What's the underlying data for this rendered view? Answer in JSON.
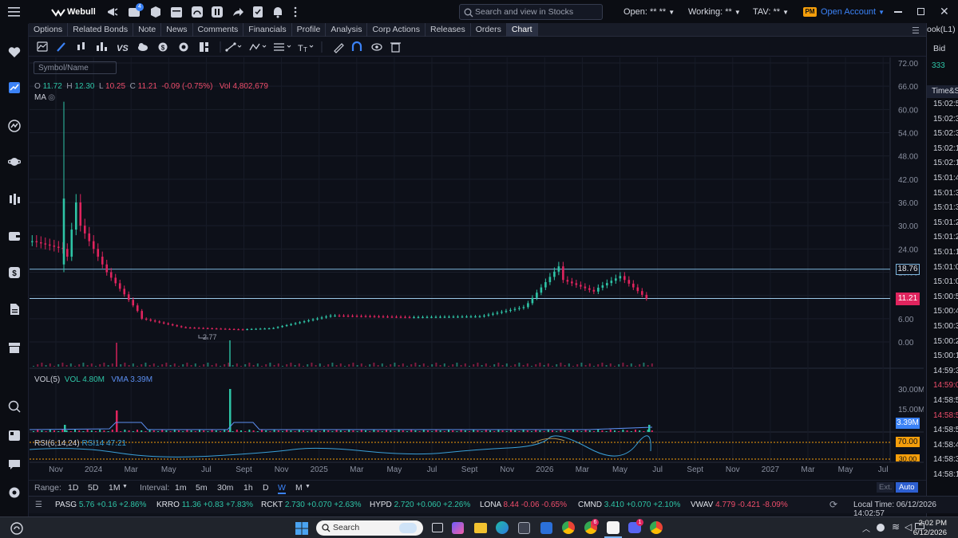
{
  "app": {
    "name": "Webull",
    "notification_badge": "4",
    "search_placeholder": "Search and view in Stocks",
    "open_label": "Open:",
    "open_value": "** **",
    "working_label": "Working:",
    "working_value": "**",
    "tav_label": "TAV:",
    "tav_value": "**",
    "pm_badge": "PM",
    "open_account": "Open Account"
  },
  "tabs": [
    "Options",
    "Related Bonds",
    "Note",
    "News",
    "Comments",
    "Financials",
    "Profile",
    "Analysis",
    "Corp Actions",
    "Releases",
    "Orders",
    "Chart"
  ],
  "active_tab": "Chart",
  "side_panel": {
    "title": "ook(L1)",
    "bid_label": "Bid",
    "bid_value": "333",
    "time_title": "Time&S",
    "times": [
      "15:02:5",
      "15:02:3",
      "15:02:3",
      "15:02:1",
      "15:02:1",
      "15:01:4",
      "15:01:3",
      "15:01:3",
      "15:01:2",
      "15:01:2",
      "15:01:1",
      "15:01:0",
      "15:01:0",
      "15:00:5",
      "15:00:4",
      "15:00:3",
      "15:00:2",
      "15:00:1",
      "14:59:3",
      "14:59:0",
      "14:58:5",
      "14:58:5",
      "14:58:5",
      "14:58:4",
      "14:58:3",
      "14:58:1"
    ]
  },
  "chart": {
    "symbol_placeholder": "Symbol/Name",
    "ohlc": {
      "o_label": "O",
      "o": "11.72",
      "h_label": "H",
      "h": "12.30",
      "l_label": "L",
      "l": "10.25",
      "c_label": "C",
      "c": "11.21",
      "change": "-0.09 (-0.75%)",
      "vol_label": "Vol",
      "vol": "4,802,679"
    },
    "ma_label": "MA",
    "low_annotation": "2.77",
    "hline_label_1": "18.76",
    "last_price_label": "11.21",
    "vol_panel": {
      "label": "VOL(5)",
      "vol": "VOL 4.80M",
      "vma": "VMA 3.39M",
      "badge": "3.39M"
    },
    "rsi_panel": {
      "label": "RSI(6,14,24)",
      "rsi14": "RSI14 47.21",
      "upper": "70.00",
      "lower": "30.00"
    }
  },
  "chart_data": {
    "type": "candlestick",
    "price_axis": [
      "72.00",
      "66.00",
      "60.00",
      "54.00",
      "48.00",
      "42.00",
      "36.00",
      "30.00",
      "24.00",
      "18.00",
      "12.00",
      "6.00",
      "0.00"
    ],
    "volume_axis": [
      "30.00M",
      "15.00M"
    ],
    "x_axis": [
      "Nov",
      "2024",
      "Mar",
      "May",
      "Jul",
      "Sept",
      "Nov",
      "2025",
      "Mar",
      "May",
      "Jul",
      "Sept",
      "Nov",
      "2026",
      "Mar",
      "May",
      "Jul",
      "Sept",
      "Nov",
      "2027",
      "Mar",
      "May",
      "Jul"
    ],
    "horizontal_lines": [
      18.76,
      11.21
    ],
    "last_price": 11.21,
    "all_time_low": 2.77,
    "price_ylim": [
      0,
      72
    ],
    "grid": true
  },
  "range_bar": {
    "range_label": "Range:",
    "ranges": [
      "1D",
      "5D",
      "1M"
    ],
    "interval_label": "Interval:",
    "intervals": [
      "1m",
      "5m",
      "30m",
      "1h",
      "D",
      "W",
      "M"
    ],
    "active_interval": "W",
    "ext": "Ext.",
    "auto": "Auto"
  },
  "ticker_tape": [
    {
      "sym": "PASG",
      "price": "5.76",
      "chg": "+0.16",
      "pct": "+2.86%",
      "dir": "up"
    },
    {
      "sym": "KRRO",
      "price": "11.36",
      "chg": "+0.83",
      "pct": "+7.83%",
      "dir": "up"
    },
    {
      "sym": "RCKT",
      "price": "2.730",
      "chg": "+0.070",
      "pct": "+2.63%",
      "dir": "up"
    },
    {
      "sym": "HYPD",
      "price": "2.720",
      "chg": "+0.060",
      "pct": "+2.26%",
      "dir": "up"
    },
    {
      "sym": "LONA",
      "price": "8.44",
      "chg": "-0.06",
      "pct": "-0.65%",
      "dir": "dn"
    },
    {
      "sym": "CMND",
      "price": "3.410",
      "chg": "+0.070",
      "pct": "+2.10%",
      "dir": "up"
    },
    {
      "sym": "VWAV",
      "price": "4.779",
      "chg": "-0.421",
      "pct": "-8.09%",
      "dir": "dn"
    }
  ],
  "local_time": "Local Time: 06/12/2026 14:02:57",
  "taskbar": {
    "search_placeholder": "Search",
    "clock_time": "2:02 PM",
    "clock_date": "6/12/2026",
    "edge_badge": "6",
    "discord_badge": "1"
  }
}
